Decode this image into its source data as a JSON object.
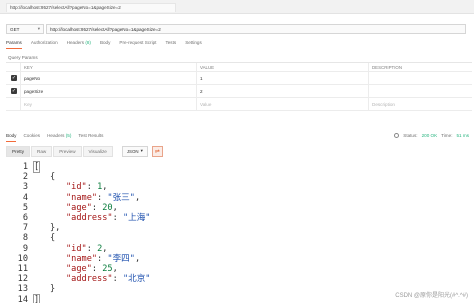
{
  "tab": {
    "title": "http://localhost:9527/selectAll?pageNo=1&pageSize=2"
  },
  "request": {
    "method": "GET",
    "url": "http://localhost:9527/selectAll?pageNo=1&pageSize=2"
  },
  "request_tabs": {
    "params": "Params",
    "authorization": "Authorization",
    "headers": "Headers",
    "headers_count": "(8)",
    "body": "Body",
    "pre_request": "Pre-request Script",
    "tests": "Tests",
    "settings": "Settings"
  },
  "query_params_label": "Query Params",
  "params_table": {
    "headers": {
      "key": "KEY",
      "value": "VALUE",
      "description": "DESCRIPTION"
    },
    "rows": [
      {
        "key": "pageNo",
        "value": "1",
        "description": ""
      },
      {
        "key": "pageSize",
        "value": "2",
        "description": ""
      }
    ],
    "placeholder": {
      "key": "Key",
      "value": "Value",
      "description": "Description"
    }
  },
  "response_tabs": {
    "body": "Body",
    "cookies": "Cookies",
    "headers": "Headers",
    "headers_count": "(5)",
    "test_results": "Test Results"
  },
  "status": {
    "label": "Status:",
    "value": "200 OK",
    "time_label": "Time:",
    "time_value": "51 ms"
  },
  "response_toolbar": {
    "pretty": "Pretty",
    "raw": "Raw",
    "preview": "Preview",
    "visualize": "Visualize",
    "format": "JSON"
  },
  "code_lines": [
    {
      "n": "1",
      "indent": 0,
      "parts": [
        {
          "t": "[",
          "c": "p"
        }
      ]
    },
    {
      "n": "2",
      "indent": 1,
      "parts": [
        {
          "t": "{",
          "c": "p"
        }
      ]
    },
    {
      "n": "3",
      "indent": 2,
      "parts": [
        {
          "t": "\"id\"",
          "c": "k"
        },
        {
          "t": ": ",
          "c": "p"
        },
        {
          "t": "1",
          "c": "n"
        },
        {
          "t": ",",
          "c": "p"
        }
      ]
    },
    {
      "n": "4",
      "indent": 2,
      "parts": [
        {
          "t": "\"name\"",
          "c": "k"
        },
        {
          "t": ": ",
          "c": "p"
        },
        {
          "t": "\"张三\"",
          "c": "s"
        },
        {
          "t": ",",
          "c": "p"
        }
      ]
    },
    {
      "n": "5",
      "indent": 2,
      "parts": [
        {
          "t": "\"age\"",
          "c": "k"
        },
        {
          "t": ": ",
          "c": "p"
        },
        {
          "t": "20",
          "c": "n"
        },
        {
          "t": ",",
          "c": "p"
        }
      ]
    },
    {
      "n": "6",
      "indent": 2,
      "parts": [
        {
          "t": "\"address\"",
          "c": "k"
        },
        {
          "t": ": ",
          "c": "p"
        },
        {
          "t": "\"上海\"",
          "c": "s"
        }
      ]
    },
    {
      "n": "7",
      "indent": 1,
      "parts": [
        {
          "t": "},",
          "c": "p"
        }
      ]
    },
    {
      "n": "8",
      "indent": 1,
      "parts": [
        {
          "t": "{",
          "c": "p"
        }
      ]
    },
    {
      "n": "9",
      "indent": 2,
      "parts": [
        {
          "t": "\"id\"",
          "c": "k"
        },
        {
          "t": ": ",
          "c": "p"
        },
        {
          "t": "2",
          "c": "n"
        },
        {
          "t": ",",
          "c": "p"
        }
      ]
    },
    {
      "n": "10",
      "indent": 2,
      "parts": [
        {
          "t": "\"name\"",
          "c": "k"
        },
        {
          "t": ": ",
          "c": "p"
        },
        {
          "t": "\"李四\"",
          "c": "s"
        },
        {
          "t": ",",
          "c": "p"
        }
      ]
    },
    {
      "n": "11",
      "indent": 2,
      "parts": [
        {
          "t": "\"age\"",
          "c": "k"
        },
        {
          "t": ": ",
          "c": "p"
        },
        {
          "t": "25",
          "c": "n"
        },
        {
          "t": ",",
          "c": "p"
        }
      ]
    },
    {
      "n": "12",
      "indent": 2,
      "parts": [
        {
          "t": "\"address\"",
          "c": "k"
        },
        {
          "t": ": ",
          "c": "p"
        },
        {
          "t": "\"北京\"",
          "c": "s"
        }
      ]
    },
    {
      "n": "13",
      "indent": 1,
      "parts": [
        {
          "t": "}",
          "c": "p"
        }
      ]
    },
    {
      "n": "14",
      "indent": 0,
      "parts": [
        {
          "t": "]",
          "c": "p"
        }
      ]
    }
  ],
  "watermark": "CSDN @原你是阳光(#^.^#)",
  "colors": {
    "accent": "#f26b3a",
    "status_ok": "#26b47f",
    "json_key": "#a31515",
    "json_string": "#1c4fae",
    "json_number": "#0a7d3d"
  }
}
